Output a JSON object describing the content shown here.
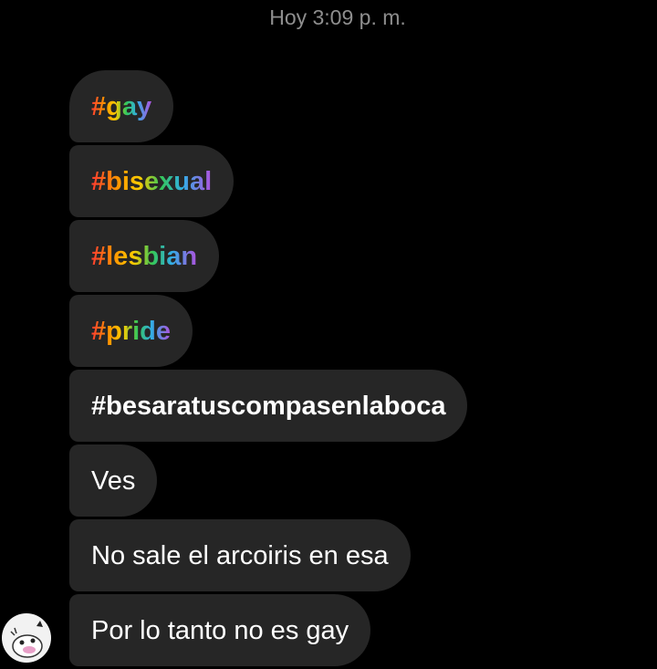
{
  "chat": {
    "timestamp": "Hoy 3:09 p. m.",
    "messages": [
      {
        "text": "#gay",
        "style": "rainbow"
      },
      {
        "text": "#bisexual",
        "style": "rainbow"
      },
      {
        "text": "#lesbian",
        "style": "rainbow"
      },
      {
        "text": "#pride",
        "style": "rainbow"
      },
      {
        "text": "#besaratuscompasenlaboca",
        "style": "bold"
      },
      {
        "text": "Ves",
        "style": "plain"
      },
      {
        "text": "No sale el arcoiris en esa",
        "style": "plain"
      },
      {
        "text": "Por lo tanto no es gay",
        "style": "plain"
      }
    ]
  },
  "colors": {
    "background": "#000000",
    "bubble": "#262626",
    "timestamp": "#8e8e8e",
    "text": "#ffffff"
  },
  "icons": {
    "avatar": "cartoon-avatar-icon"
  }
}
